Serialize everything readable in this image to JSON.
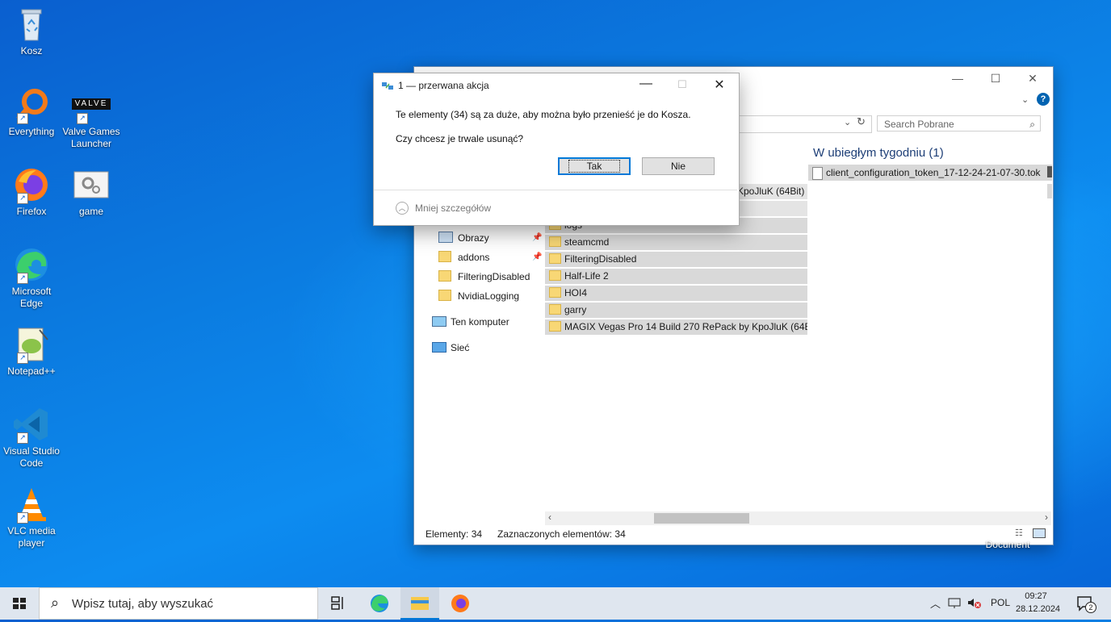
{
  "desktop": {
    "icons": [
      {
        "label": "Kosz",
        "icon": "recycle-bin-icon"
      },
      {
        "label": "Everything",
        "icon": "everything-search-icon"
      },
      {
        "label": "Valve Games Launcher",
        "icon": "valve-icon"
      },
      {
        "label": "Firefox",
        "icon": "firefox-icon"
      },
      {
        "label": "game",
        "icon": "game-gears-icon"
      },
      {
        "label": "Microsoft Edge",
        "icon": "edge-icon"
      },
      {
        "label": "Notepad++",
        "icon": "notepad-plus-plus-icon"
      },
      {
        "label": "Visual Studio Code",
        "icon": "vscode-icon"
      },
      {
        "label": "VLC media player",
        "icon": "vlc-icon"
      }
    ],
    "valve_logo_text": "VALVE",
    "partial_label": "Document"
  },
  "explorer": {
    "search_placeholder": "Search Pobrane",
    "group_title": "W ubiegłym tygodniu (1)",
    "right_file": "client_configuration_token_17-12-24-21-07-30.tok",
    "partial_row": "KpoJluK (64Bit)",
    "nav": [
      {
        "label": "Obrazy",
        "pinned": true
      },
      {
        "label": "addons",
        "pinned": true
      },
      {
        "label": "FilteringDisabled",
        "pinned": false
      },
      {
        "label": "NvidiaLogging",
        "pinned": false
      },
      {
        "label": "Ten komputer",
        "pinned": false
      },
      {
        "label": "Sieć",
        "pinned": false
      }
    ],
    "rows": [
      "logs",
      "steamcmd",
      "FilteringDisabled",
      "Half-Life 2",
      "HOI4",
      "garry",
      "MAGIX Vegas Pro 14 Build 270 RePack by KpoJluK (64Bit)"
    ],
    "status_count": "Elementy: 34",
    "status_selected": "Zaznaczonych elementów: 34"
  },
  "dialog": {
    "title": "1 — przerwana akcja",
    "message": "Te elementy (34) są za duże, aby można było przenieść je do Kosza.",
    "question": "Czy chcesz je trwale usunąć?",
    "yes": "Tak",
    "no": "Nie",
    "details": "Mniej szczegółów"
  },
  "taskbar": {
    "search_placeholder": "Wpisz tutaj, aby wyszukać",
    "language": "POL",
    "time": "09:27",
    "date": "28.12.2024",
    "notification_count": "2"
  },
  "colors": {
    "accent": "#0078d7",
    "selection": "#d9d9d9",
    "folder": "#f8d775",
    "group_title": "#1e3f77"
  }
}
